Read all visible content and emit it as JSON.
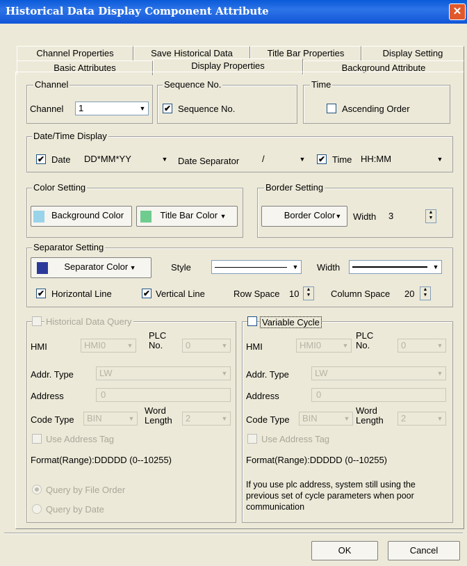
{
  "window": {
    "title": "Historical Data Display Component Attribute",
    "close": "✕"
  },
  "tabs_row1": [
    "Channel Properties",
    "Save Historical Data",
    "Title Bar Properties",
    "Display Setting"
  ],
  "tabs_row2": [
    "Basic Attributes",
    "Display Properties",
    "Background Attribute"
  ],
  "channel": {
    "legend": "Channel",
    "label": "Channel",
    "value": "1"
  },
  "sequence": {
    "legend": "Sequence No.",
    "checkbox_label": "Sequence No.",
    "checked": "✔"
  },
  "time": {
    "legend": "Time",
    "checkbox_label": "Ascending Order"
  },
  "datetime": {
    "legend": "Date/Time Display",
    "date_label": "Date",
    "date_value": "DD*MM*YY",
    "separator_label": "Date Separator",
    "separator_value": "/",
    "time_label": "Time",
    "time_value": "HH:MM",
    "check": "✔"
  },
  "color_setting": {
    "legend": "Color Setting",
    "background_btn": "Background Color",
    "titlebar_btn": "Title Bar Color",
    "bg_swatch": "#9ad4ea",
    "tb_swatch": "#6fcc8f"
  },
  "border_setting": {
    "legend": "Border Setting",
    "border_btn": "Border Color",
    "width_label": "Width",
    "width_value": "3"
  },
  "separator_setting": {
    "legend": "Separator Setting",
    "sep_btn": "Separator Color",
    "sep_swatch": "#2b3a9a",
    "style_label": "Style",
    "width_label": "Width",
    "h_line": "Horizontal Line",
    "v_line": "Vertical Line",
    "row_space_label": "Row Space",
    "row_space": "10",
    "col_space_label": "Column Space",
    "col_space": "20",
    "check": "✔"
  },
  "query": {
    "legend": "Historical Data Query",
    "hmi_label": "HMI",
    "hmi_value": "HMI0",
    "plc_label": "PLC",
    "plc_label2": "No.",
    "plc_value": "0",
    "addr_type_label": "Addr. Type",
    "addr_type_value": "LW",
    "address_label": "Address",
    "address_value": "0",
    "code_type_label": "Code Type",
    "code_type_value": "BIN",
    "word_label": "Word",
    "word_label2": "Length",
    "word_value": "2",
    "use_tag": "Use Address Tag",
    "format": "Format(Range):DDDDD (0--10255)",
    "radio_file": "Query by File Order",
    "radio_date": "Query by Date"
  },
  "variable": {
    "legend": "Variable Cycle",
    "hmi_label": "HMI",
    "hmi_value": "HMI0",
    "plc_label": "PLC",
    "plc_label2": "No.",
    "plc_value": "0",
    "addr_type_label": "Addr. Type",
    "addr_type_value": "LW",
    "address_label": "Address",
    "address_value": "0",
    "code_type_label": "Code Type",
    "code_type_value": "BIN",
    "word_label": "Word",
    "word_label2": "Length",
    "word_value": "2",
    "use_tag": "Use Address Tag",
    "format": "Format(Range):DDDDD (0--10255)",
    "note1": "If you use plc address, system still using the",
    "note2": "previous set of cycle parameters when poor",
    "note3": "communication"
  },
  "footer": {
    "ok": "OK",
    "cancel": "Cancel"
  }
}
